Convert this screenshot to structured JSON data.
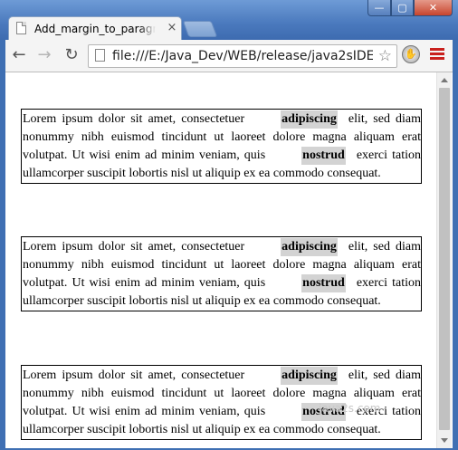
{
  "window": {
    "tab_title": "Add_margin_to_paragraph",
    "tab_close": "×",
    "buttons": {
      "minimize": "—",
      "maximize": "▢",
      "close": "✕"
    }
  },
  "toolbar": {
    "back": "←",
    "forward": "→",
    "reload": "↻",
    "url": "file:///E:/Java_Dev/WEB/release/java2sIDE",
    "star": "☆",
    "extension": "✋"
  },
  "paragraphs": [
    {
      "t1": "Lorem ipsum dolor sit amet, consectetuer",
      "e1": "adipiscing",
      "t2": "elit, sed diam nonummy nibh euismod tincidunt ut laoreet dolore magna aliquam erat volutpat. Ut wisi enim ad minim veniam, quis",
      "e2": "nostrud",
      "t3": "exerci tation ullamcorper suscipit lobortis nisl ut aliquip ex ea commodo consequat."
    },
    {
      "t1": "Lorem ipsum dolor sit amet, consectetuer",
      "e1": "adipiscing",
      "t2": "elit, sed diam nonummy nibh euismod tincidunt ut laoreet dolore magna aliquam erat volutpat. Ut wisi enim ad minim veniam, quis",
      "e2": "nostrud",
      "t3": "exerci tation ullamcorper suscipit lobortis nisl ut aliquip ex ea commodo consequat."
    },
    {
      "t1": "Lorem ipsum dolor sit amet, consectetuer",
      "e1": "adipiscing",
      "t2": "elit, sed diam nonummy nibh euismod tincidunt ut laoreet dolore magna aliquam erat volutpat. Ut wisi enim ad minim veniam, quis",
      "e2": "nostrud",
      "t3": "exerci tation ullamcorper suscipit lobortis nisl ut aliquip ex ea commodo consequat."
    }
  ],
  "watermark": "java2s.com",
  "colors": {
    "titlebar": "#4a79bd",
    "highlight": "#d3d3d3",
    "menu_icon": "#c9211e"
  }
}
